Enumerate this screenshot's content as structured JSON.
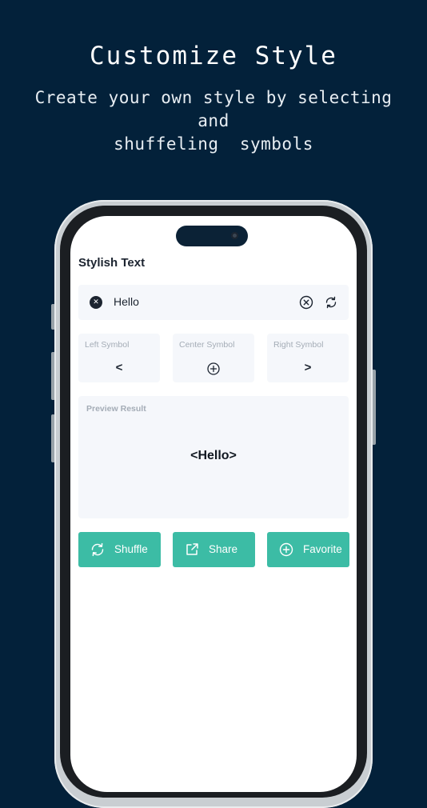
{
  "promo": {
    "headline": "Customize Style",
    "subhead_line1": "Create your own style by selecting and",
    "subhead_line2": "shuffeling  symbols"
  },
  "app": {
    "title": "Stylish Text",
    "input": {
      "value": "Hello",
      "leading_icon": "close-circle-filled-icon",
      "clear_icon": "close-circle-outline-icon",
      "refresh_icon": "refresh-icon"
    },
    "symbols": [
      {
        "label": "Left Symbol",
        "value": "<"
      },
      {
        "label": "Center Symbol",
        "icon": "add-circle-icon"
      },
      {
        "label": "Right Symbol",
        "value": ">"
      }
    ],
    "preview": {
      "label": "Preview Result",
      "result": "<Hello>"
    },
    "buttons": [
      {
        "label": "Shuffle",
        "icon": "shuffle-icon"
      },
      {
        "label": "Share",
        "icon": "share-icon"
      },
      {
        "label": "Favorite",
        "icon": "add-circle-icon"
      }
    ]
  },
  "colors": {
    "background": "#03213a",
    "accent": "#3cbca5",
    "card": "#f5f7fb"
  }
}
